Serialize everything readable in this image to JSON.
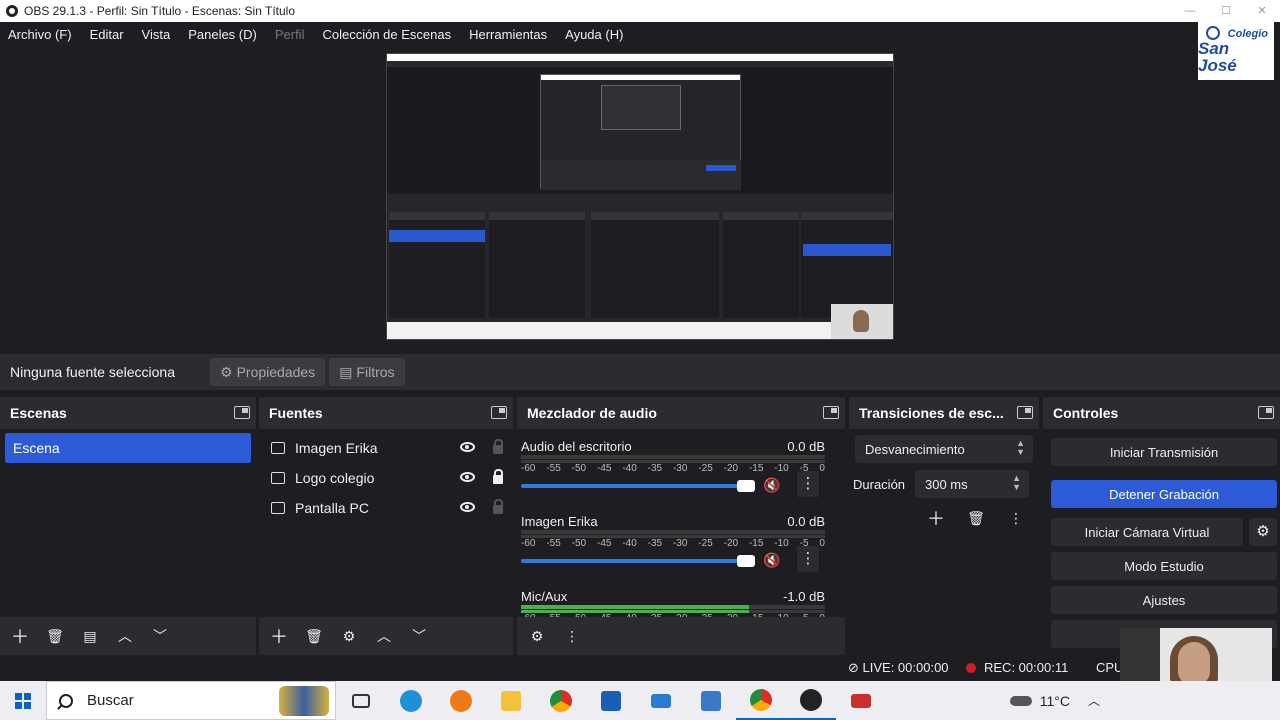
{
  "window": {
    "title": "OBS 29.1.3 - Perfil: Sin Título - Escenas: Sin Título"
  },
  "menu": [
    {
      "label": "Archivo (F)",
      "enabled": true
    },
    {
      "label": "Editar",
      "enabled": true
    },
    {
      "label": "Vista",
      "enabled": true
    },
    {
      "label": "Paneles (D)",
      "enabled": true
    },
    {
      "label": "Perfil",
      "enabled": false
    },
    {
      "label": "Colección de Escenas",
      "enabled": true
    },
    {
      "label": "Herramientas",
      "enabled": true
    },
    {
      "label": "Ayuda (H)",
      "enabled": true
    }
  ],
  "overlay_logo": {
    "line1": "Colegio",
    "line2": "San José"
  },
  "source_toolbar": {
    "status": "Ninguna fuente selecciona",
    "properties_label": "Propiedades",
    "filters_label": "Filtros"
  },
  "scenes": {
    "title": "Escenas",
    "items": [
      {
        "label": "Escena",
        "selected": true
      }
    ]
  },
  "sources": {
    "title": "Fuentes",
    "items": [
      {
        "label": "Imagen Erika",
        "icon": "camera-icon",
        "visible": true,
        "locked": false
      },
      {
        "label": "Logo colegio",
        "icon": "image-icon",
        "visible": true,
        "locked": true
      },
      {
        "label": "Pantalla PC",
        "icon": "monitor-icon",
        "visible": true,
        "locked": false
      }
    ]
  },
  "mixer": {
    "title": "Mezclador de audio",
    "ticks": [
      "-60",
      "-55",
      "-50",
      "-45",
      "-40",
      "-35",
      "-30",
      "-25",
      "-20",
      "-15",
      "-10",
      "-5",
      "0"
    ],
    "channels": [
      {
        "name": "Audio del escritorio",
        "db": "0.0 dB",
        "volume": 1.0,
        "muted": true,
        "level": 0.0
      },
      {
        "name": "Imagen Erika",
        "db": "0.0 dB",
        "volume": 1.0,
        "muted": true,
        "level": 0.0
      },
      {
        "name": "Mic/Aux",
        "db": "-1.0 dB",
        "volume": 0.97,
        "muted": false,
        "level": 0.75
      }
    ]
  },
  "transitions": {
    "title": "Transiciones de esc...",
    "selected": "Desvanecimiento",
    "duration_label": "Duración",
    "duration_value": "300 ms"
  },
  "controls": {
    "title": "Controles",
    "buttons": [
      {
        "label": "Iniciar Transmisión",
        "active": false
      },
      {
        "label": "Detener Grabación",
        "active": true
      },
      {
        "label": "Iniciar Cámara Virtual",
        "active": false
      },
      {
        "label": "Modo Estudio",
        "active": false
      },
      {
        "label": "Ajustes",
        "active": false
      }
    ]
  },
  "status": {
    "live": "LIVE: 00:00:00",
    "rec": "REC: 00:00:11",
    "cpu": "CPU"
  },
  "taskbar": {
    "search_placeholder": "Buscar",
    "temperature": "11°C"
  },
  "colors": {
    "accent": "#2d5ad6",
    "background": "#1e1e22",
    "record": "#d02020"
  }
}
